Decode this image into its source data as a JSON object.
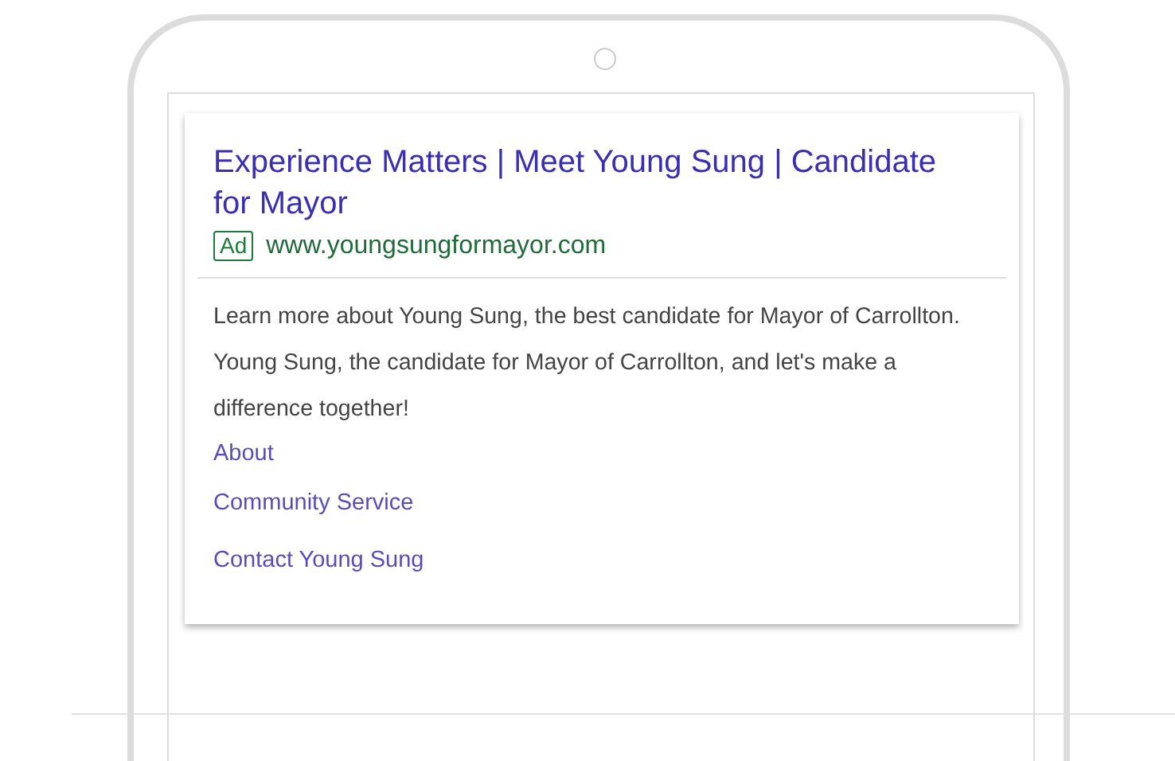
{
  "ad": {
    "title": "Experience Matters | Meet Young Sung | Candidate for Mayor",
    "badge": "Ad",
    "url": "www.youngsungformayor.com",
    "description": "Learn more about Young Sung, the best candidate for Mayor of Carrollton. Young Sung, the candidate for Mayor of Carrollton, and let's make a difference together!",
    "sitelinks": [
      "About",
      "Community Service",
      "Contact Young Sung"
    ]
  }
}
